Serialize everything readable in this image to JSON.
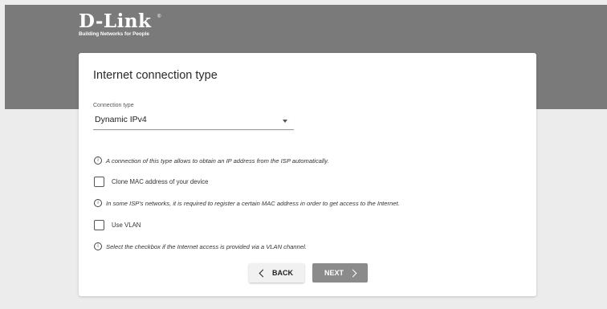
{
  "brand": {
    "logo": "D-Link",
    "registered": "®",
    "tagline": "Building Networks for People"
  },
  "page": {
    "title": "Internet connection type"
  },
  "connection": {
    "label": "Connection type",
    "value": "Dynamic IPv4"
  },
  "info": {
    "dynamic": "A connection of this type allows to obtain an IP address from the ISP automatically.",
    "mac": "In some ISP's networks, it is required to register a certain MAC address in order to get access to the Internet.",
    "vlan": "Select the checkbox if the Internet access is provided via a VLAN channel."
  },
  "options": {
    "clone_mac": "Clone MAC address of your device",
    "use_vlan": "Use VLAN"
  },
  "buttons": {
    "back": "BACK",
    "next": "NEXT"
  }
}
